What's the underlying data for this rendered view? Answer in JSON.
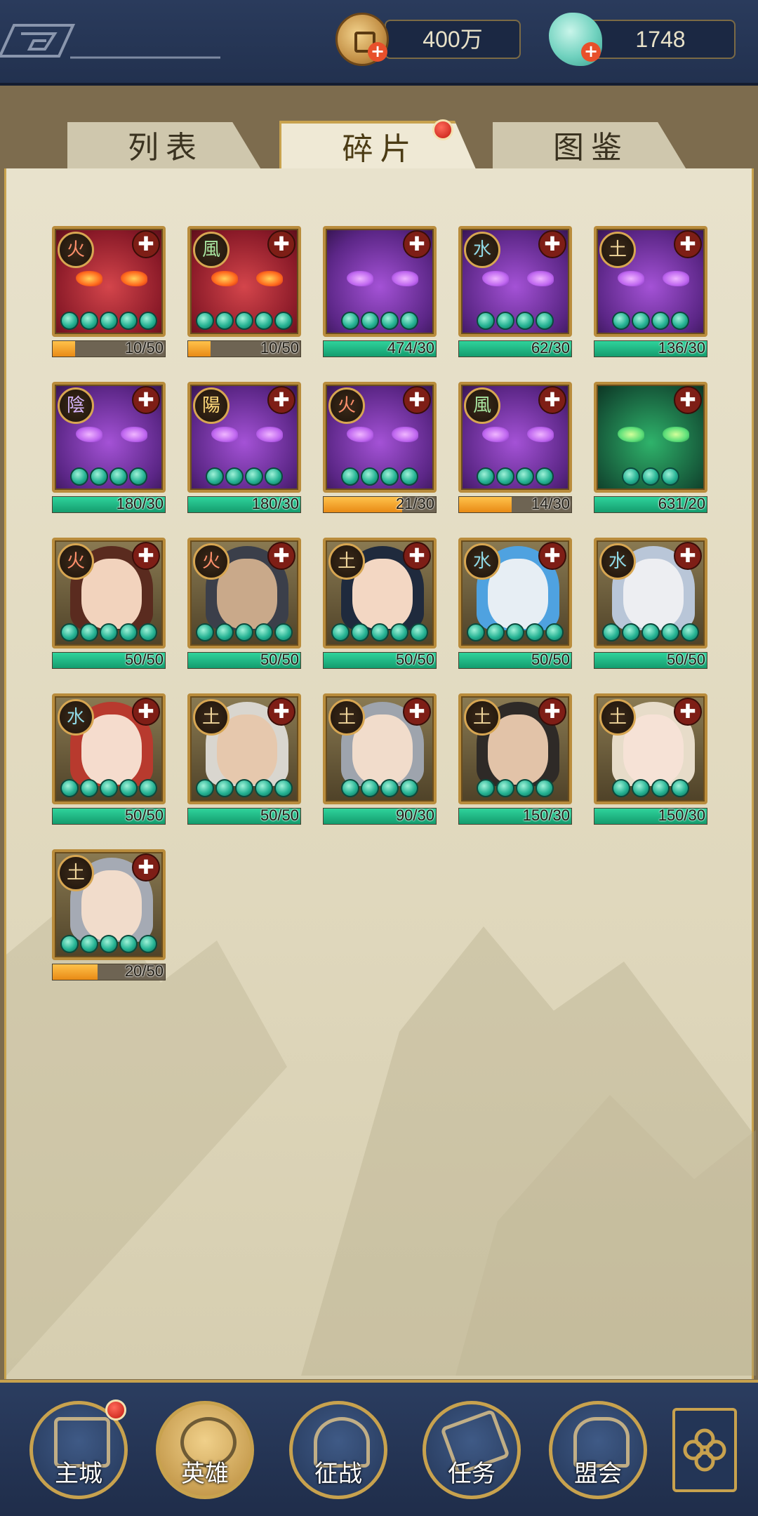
{
  "resources": {
    "coins": "400万",
    "jade": "1748"
  },
  "tabs": [
    {
      "label": "列表",
      "active": false
    },
    {
      "label": "碎片",
      "active": true
    },
    {
      "label": "图鉴",
      "active": false
    }
  ],
  "cards": [
    {
      "type": "red",
      "element": "火",
      "stars": 5,
      "progress": "10/50",
      "fill": 0.2,
      "color": "orange"
    },
    {
      "type": "red",
      "element": "風",
      "stars": 5,
      "progress": "10/50",
      "fill": 0.2,
      "color": "orange"
    },
    {
      "type": "purple",
      "element": "",
      "stars": 4,
      "progress": "474/30",
      "fill": 1,
      "color": "green"
    },
    {
      "type": "purple",
      "element": "水",
      "stars": 4,
      "progress": "62/30",
      "fill": 1,
      "color": "green"
    },
    {
      "type": "purple",
      "element": "土",
      "stars": 4,
      "progress": "136/30",
      "fill": 1,
      "color": "green"
    },
    {
      "type": "purple",
      "element": "陰",
      "stars": 4,
      "progress": "180/30",
      "fill": 1,
      "color": "green"
    },
    {
      "type": "purple",
      "element": "陽",
      "stars": 4,
      "progress": "180/30",
      "fill": 1,
      "color": "green"
    },
    {
      "type": "purple",
      "element": "火",
      "stars": 4,
      "progress": "21/30",
      "fill": 0.7,
      "color": "orange"
    },
    {
      "type": "purple",
      "element": "風",
      "stars": 4,
      "progress": "14/30",
      "fill": 0.47,
      "color": "orange"
    },
    {
      "type": "green",
      "element": "",
      "stars": 3,
      "progress": "631/20",
      "fill": 1,
      "color": "green"
    },
    {
      "type": "portrait",
      "element": "火",
      "stars": 5,
      "progress": "50/50",
      "fill": 1,
      "color": "green",
      "hair": "#5a2b1f",
      "skin": "#f2d3bd"
    },
    {
      "type": "portrait",
      "element": "火",
      "stars": 5,
      "progress": "50/50",
      "fill": 1,
      "color": "green",
      "hair": "#3b3f4a",
      "skin": "#c9a98a"
    },
    {
      "type": "portrait",
      "element": "土",
      "stars": 5,
      "progress": "50/50",
      "fill": 1,
      "color": "green",
      "hair": "#1f2a3d",
      "skin": "#f3d7c3"
    },
    {
      "type": "portrait",
      "element": "水",
      "stars": 5,
      "progress": "50/50",
      "fill": 1,
      "color": "green",
      "hair": "#4fa2e0",
      "skin": "#e7eef4"
    },
    {
      "type": "portrait",
      "element": "水",
      "stars": 5,
      "progress": "50/50",
      "fill": 1,
      "color": "green",
      "hair": "#b9c6d8",
      "skin": "#edeef2"
    },
    {
      "type": "portrait",
      "element": "水",
      "stars": 5,
      "progress": "50/50",
      "fill": 1,
      "color": "green",
      "hair": "#b83a2e",
      "skin": "#f5dccd"
    },
    {
      "type": "portrait",
      "element": "土",
      "stars": 5,
      "progress": "50/50",
      "fill": 1,
      "color": "green",
      "hair": "#d9d6cf",
      "skin": "#e6c8ad"
    },
    {
      "type": "portrait",
      "element": "土",
      "stars": 4,
      "progress": "90/30",
      "fill": 1,
      "color": "green",
      "hair": "#9ea4ad",
      "skin": "#f1dccb"
    },
    {
      "type": "portrait",
      "element": "土",
      "stars": 4,
      "progress": "150/30",
      "fill": 1,
      "color": "green",
      "hair": "#2e2a27",
      "skin": "#e2c3a8"
    },
    {
      "type": "portrait",
      "element": "土",
      "stars": 4,
      "progress": "150/30",
      "fill": 1,
      "color": "green",
      "hair": "#e7dcc9",
      "skin": "#f6e2d6"
    },
    {
      "type": "portrait",
      "element": "土",
      "stars": 5,
      "progress": "20/50",
      "fill": 0.4,
      "color": "orange",
      "hair": "#a5aab4",
      "skin": "#f1dccb"
    }
  ],
  "nav": [
    {
      "label": "主城",
      "icon": "city-icon",
      "badge": true,
      "active": false
    },
    {
      "label": "英雄",
      "icon": "hero-icon",
      "badge": false,
      "active": true
    },
    {
      "label": "征战",
      "icon": "battle-icon",
      "badge": false,
      "active": false
    },
    {
      "label": "任务",
      "icon": "quest-icon",
      "badge": false,
      "active": false
    },
    {
      "label": "盟会",
      "icon": "guild-icon",
      "badge": false,
      "active": false
    }
  ]
}
